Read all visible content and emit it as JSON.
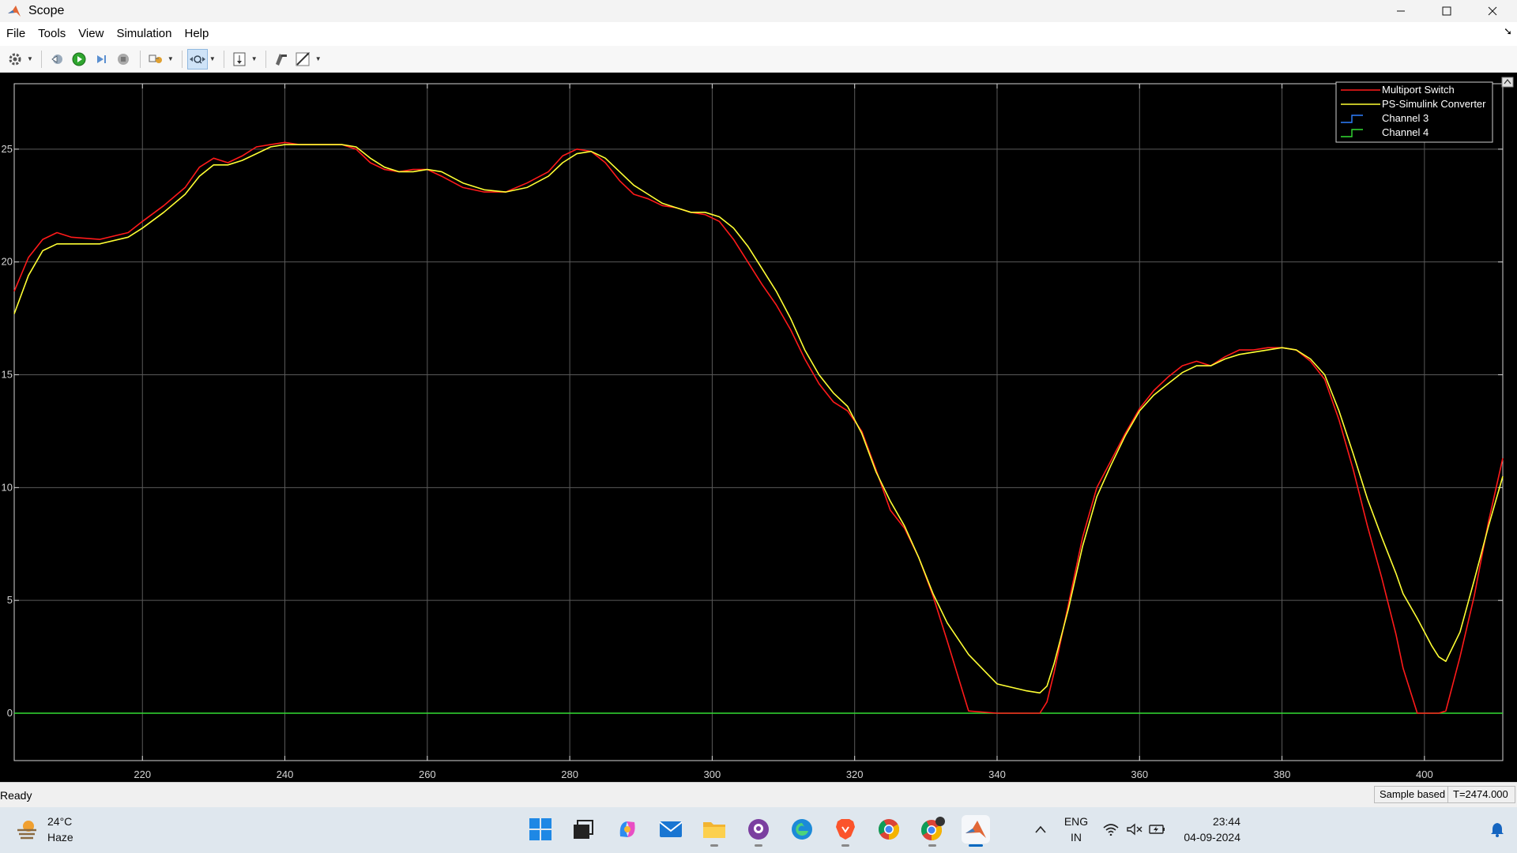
{
  "window": {
    "title": "Scope"
  },
  "menu": [
    "File",
    "Tools",
    "View",
    "Simulation",
    "Help"
  ],
  "toolbar": {
    "icons": [
      "configuration-properties-icon",
      "step-back-icon",
      "run-icon",
      "step-forward-icon",
      "stop-icon",
      "simulation-settings-icon",
      "zoom-icon",
      "axes-scaling-icon",
      "highlight-icon",
      "measurements-icon"
    ]
  },
  "chart_data": {
    "type": "line",
    "xlim": [
      202,
      411
    ],
    "ylim": [
      -2.1,
      27.9
    ],
    "xticks": [
      220,
      240,
      260,
      280,
      300,
      320,
      340,
      360,
      380,
      400
    ],
    "yticks": [
      0,
      5,
      10,
      15,
      20,
      25
    ],
    "grid": true,
    "background": "#000000",
    "axis_color": "#d4d4d4",
    "legend_position": "top-right",
    "legend": [
      {
        "name": "Multiport Switch",
        "color": "#ff1a1a"
      },
      {
        "name": "PS-Simulink Converter",
        "color": "#ffff33"
      },
      {
        "name": "Channel 3",
        "color": "#2f7fff"
      },
      {
        "name": "Channel 4",
        "color": "#33dd33"
      }
    ],
    "series": [
      {
        "name": "Multiport Switch",
        "color": "#ff1a1a",
        "x": [
          202,
          204,
          206,
          208,
          210,
          214,
          218,
          220,
          223,
          226,
          228,
          230,
          232,
          234,
          236,
          238,
          240,
          242,
          245,
          248,
          250,
          252,
          254,
          256,
          258,
          260,
          262,
          265,
          268,
          271,
          274,
          277,
          279,
          281,
          283,
          285,
          287,
          289,
          291,
          293,
          295,
          297,
          299,
          301,
          303,
          305,
          307,
          309,
          311,
          313,
          315,
          317,
          319,
          321,
          323,
          325,
          327,
          329,
          331,
          333,
          336,
          340,
          344,
          346,
          347,
          348,
          350,
          352,
          354,
          356,
          358,
          360,
          362,
          364,
          366,
          368,
          370,
          372,
          374,
          376,
          378,
          380,
          382,
          384,
          386,
          388,
          390,
          392,
          394,
          396,
          397,
          399,
          401,
          402,
          403,
          405,
          407,
          409,
          411
        ],
        "y": [
          18.7,
          20.2,
          21.0,
          21.3,
          21.1,
          21.0,
          21.3,
          21.8,
          22.5,
          23.3,
          24.2,
          24.6,
          24.4,
          24.7,
          25.1,
          25.2,
          25.3,
          25.2,
          25.2,
          25.2,
          25.0,
          24.4,
          24.1,
          24.0,
          24.1,
          24.1,
          23.8,
          23.3,
          23.1,
          23.1,
          23.5,
          24.0,
          24.7,
          25.0,
          24.9,
          24.4,
          23.6,
          23.0,
          22.8,
          22.5,
          22.4,
          22.2,
          22.1,
          21.8,
          21.0,
          20.0,
          19.0,
          18.1,
          17.0,
          15.7,
          14.6,
          13.8,
          13.4,
          12.5,
          10.8,
          9.0,
          8.2,
          6.9,
          5.2,
          3.2,
          0.1,
          0.0,
          0.0,
          0.0,
          0.5,
          1.8,
          4.8,
          7.8,
          10.0,
          11.2,
          12.4,
          13.5,
          14.3,
          14.9,
          15.4,
          15.6,
          15.4,
          15.8,
          16.1,
          16.1,
          16.2,
          16.2,
          16.1,
          15.6,
          14.8,
          13.0,
          10.8,
          8.3,
          6.0,
          3.5,
          2.0,
          0.0,
          0.0,
          0.0,
          0.1,
          2.5,
          5.2,
          8.5,
          11.3
        ]
      },
      {
        "name": "PS-Simulink Converter",
        "color": "#ffff33",
        "x": [
          202,
          204,
          206,
          208,
          210,
          214,
          218,
          220,
          223,
          226,
          228,
          230,
          232,
          234,
          236,
          238,
          240,
          242,
          245,
          248,
          250,
          252,
          254,
          256,
          258,
          260,
          262,
          265,
          268,
          271,
          274,
          277,
          279,
          281,
          283,
          285,
          287,
          289,
          291,
          293,
          295,
          297,
          299,
          301,
          303,
          305,
          307,
          309,
          311,
          313,
          315,
          317,
          319,
          321,
          323,
          325,
          327,
          329,
          331,
          333,
          336,
          340,
          344,
          346,
          347,
          348,
          350,
          352,
          354,
          356,
          358,
          360,
          362,
          364,
          366,
          368,
          370,
          372,
          374,
          376,
          378,
          380,
          382,
          384,
          386,
          388,
          390,
          392,
          394,
          396,
          397,
          399,
          401,
          402,
          403,
          405,
          407,
          409,
          411
        ],
        "y": [
          17.7,
          19.4,
          20.5,
          20.8,
          20.8,
          20.8,
          21.1,
          21.5,
          22.2,
          23.0,
          23.8,
          24.3,
          24.3,
          24.5,
          24.8,
          25.1,
          25.2,
          25.2,
          25.2,
          25.2,
          25.1,
          24.6,
          24.2,
          24.0,
          24.0,
          24.1,
          24.0,
          23.5,
          23.2,
          23.1,
          23.3,
          23.8,
          24.4,
          24.8,
          24.9,
          24.6,
          24.0,
          23.4,
          23.0,
          22.6,
          22.4,
          22.2,
          22.2,
          22.0,
          21.5,
          20.7,
          19.7,
          18.7,
          17.5,
          16.1,
          15.0,
          14.2,
          13.6,
          12.4,
          10.7,
          9.4,
          8.3,
          6.9,
          5.3,
          4.0,
          2.6,
          1.3,
          1.0,
          0.9,
          1.2,
          2.2,
          4.6,
          7.4,
          9.6,
          11.0,
          12.3,
          13.4,
          14.1,
          14.6,
          15.1,
          15.4,
          15.4,
          15.7,
          15.9,
          16.0,
          16.1,
          16.2,
          16.1,
          15.7,
          15.0,
          13.4,
          11.5,
          9.5,
          7.8,
          6.2,
          5.3,
          4.2,
          3.0,
          2.5,
          2.3,
          3.6,
          5.9,
          8.3,
          10.5
        ]
      },
      {
        "name": "Channel 4",
        "color": "#33dd33",
        "x": [
          202,
          411
        ],
        "y": [
          0,
          0
        ]
      }
    ]
  },
  "status": {
    "text": "Ready",
    "sample_mode": "Sample based",
    "time": "T=2474.000"
  },
  "taskbar": {
    "weather_temp": "24°C",
    "weather_desc": "Haze",
    "lang_1": "ENG",
    "lang_2": "IN",
    "time": "23:44",
    "date": "04-09-2024",
    "apps": [
      "windows-start-icon",
      "task-view-icon",
      "copilot-icon",
      "mail-icon",
      "file-explorer-icon",
      "github-desktop-icon",
      "edge-icon",
      "brave-icon",
      "chrome-icon",
      "chrome-profile-icon",
      "matlab-icon"
    ]
  }
}
